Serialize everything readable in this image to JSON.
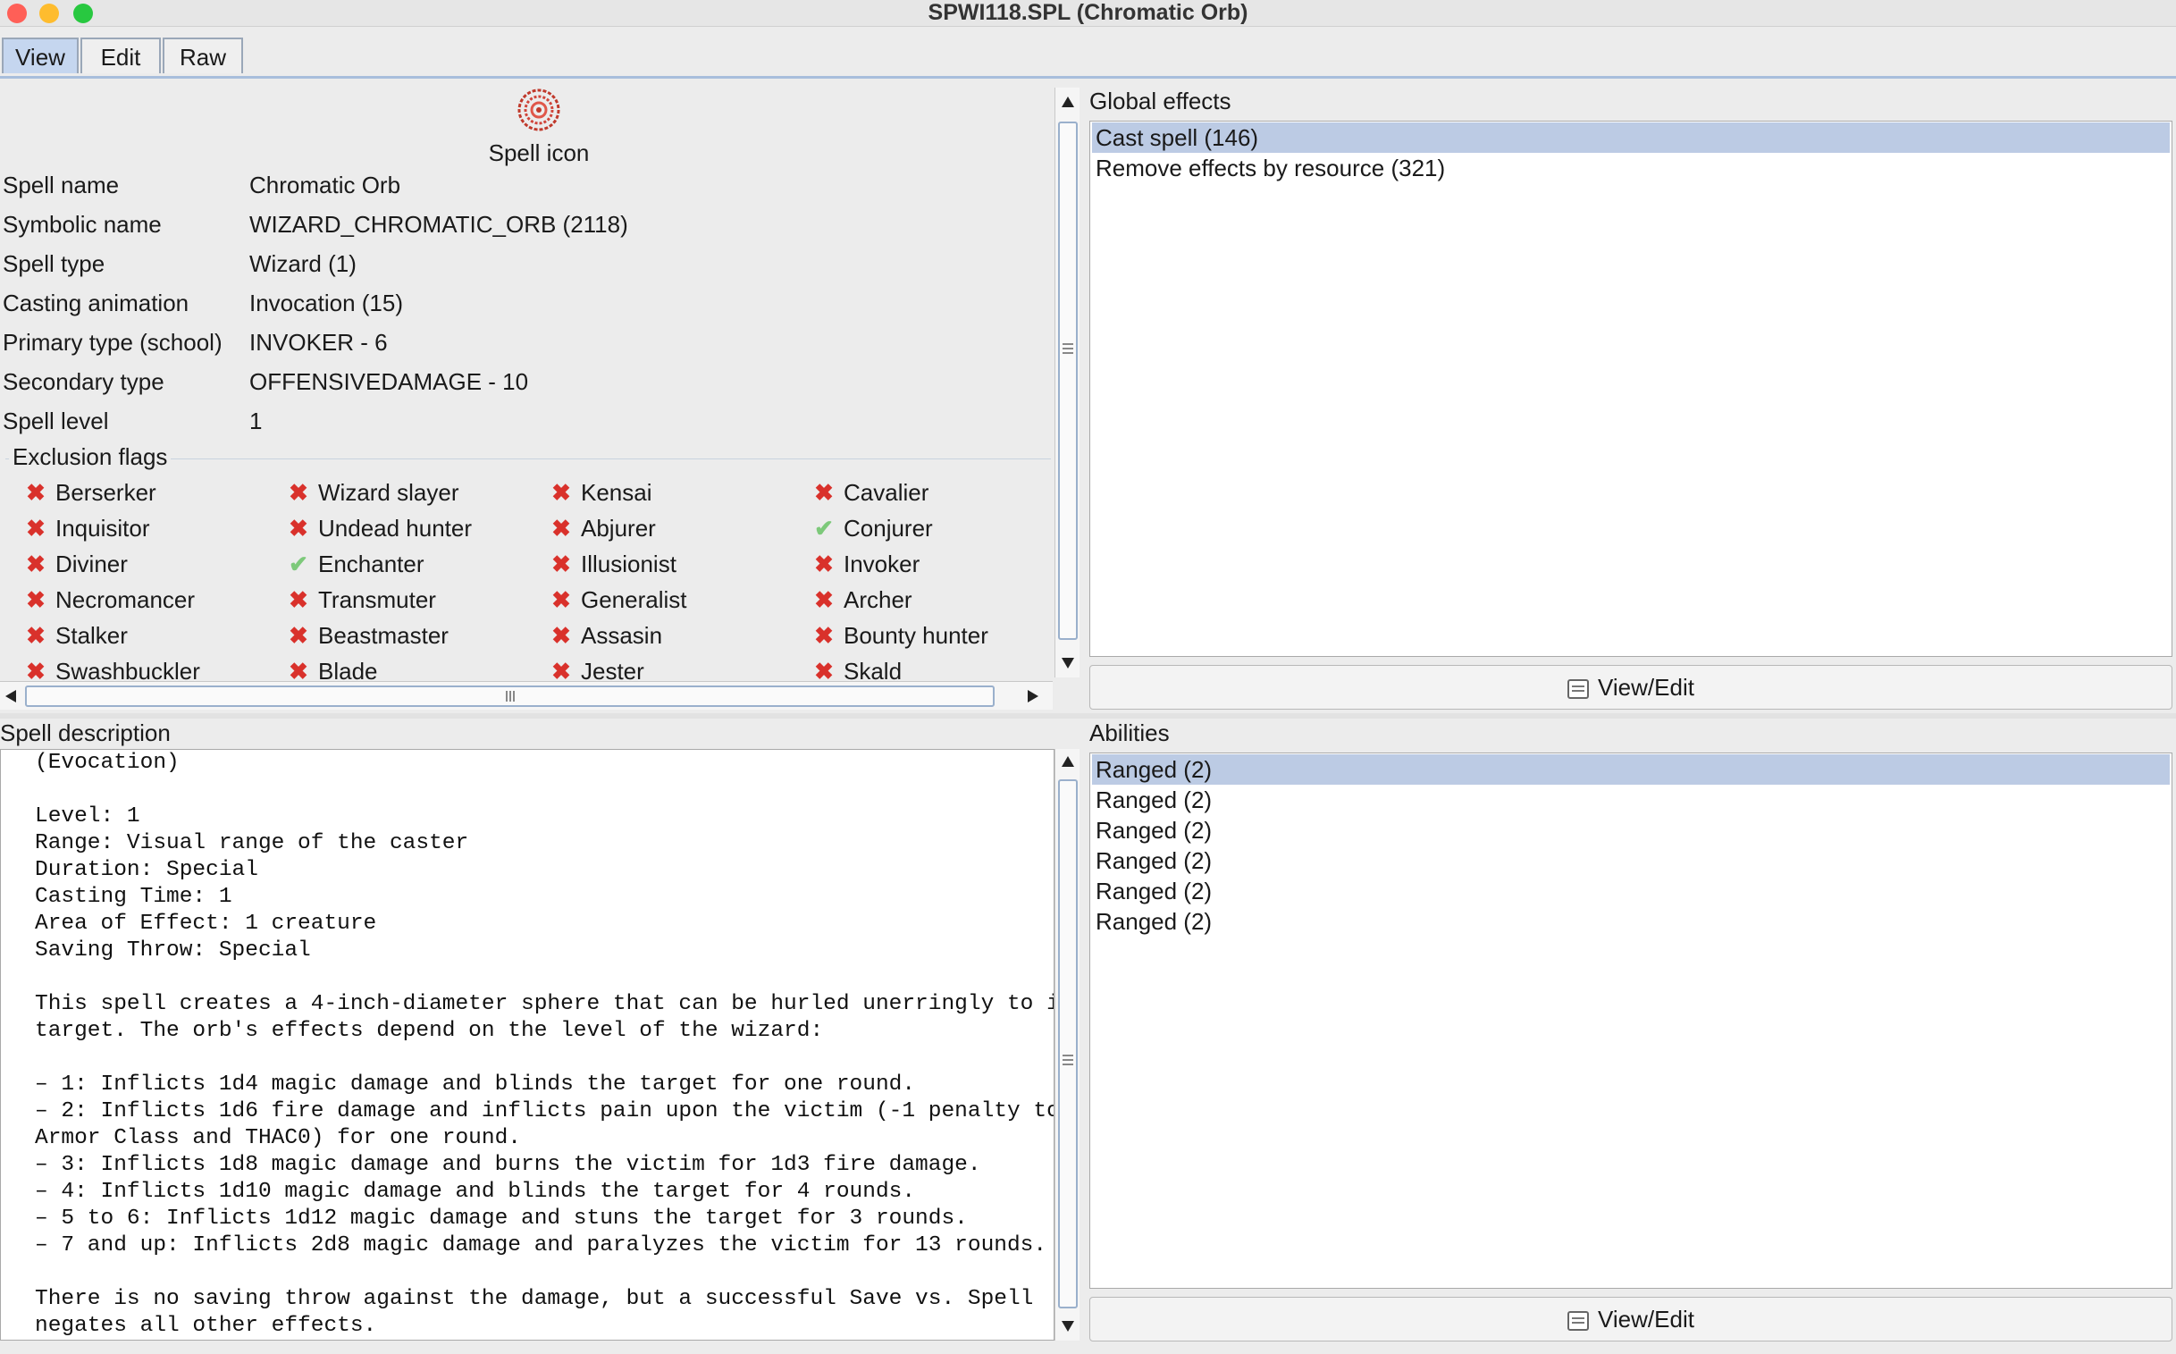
{
  "window": {
    "title": "SPWI118.SPL (Chromatic Orb)",
    "tabs": [
      "View",
      "Edit",
      "Raw"
    ]
  },
  "spell": {
    "icon_label": "Spell icon",
    "fields": [
      {
        "label": "Spell name",
        "value": "Chromatic Orb"
      },
      {
        "label": "Symbolic name",
        "value": "WIZARD_CHROMATIC_ORB (2118)"
      },
      {
        "label": "Spell type",
        "value": "Wizard (1)"
      },
      {
        "label": "Casting animation",
        "value": "Invocation (15)"
      },
      {
        "label": "Primary type (school)",
        "value": "INVOKER - 6"
      },
      {
        "label": "Secondary type",
        "value": "OFFENSIVEDAMAGE - 10"
      },
      {
        "label": "Spell level",
        "value": "1"
      }
    ]
  },
  "exclusion_flags": {
    "title": "Exclusion flags",
    "items": [
      {
        "name": "Berserker",
        "state": "excluded"
      },
      {
        "name": "Wizard slayer",
        "state": "excluded"
      },
      {
        "name": "Kensai",
        "state": "excluded"
      },
      {
        "name": "Cavalier",
        "state": "excluded"
      },
      {
        "name": "Inquisitor",
        "state": "excluded"
      },
      {
        "name": "Undead hunter",
        "state": "excluded"
      },
      {
        "name": "Abjurer",
        "state": "excluded"
      },
      {
        "name": "Conjurer",
        "state": "allowed"
      },
      {
        "name": "Diviner",
        "state": "excluded"
      },
      {
        "name": "Enchanter",
        "state": "allowed"
      },
      {
        "name": "Illusionist",
        "state": "excluded"
      },
      {
        "name": "Invoker",
        "state": "excluded"
      },
      {
        "name": "Necromancer",
        "state": "excluded"
      },
      {
        "name": "Transmuter",
        "state": "excluded"
      },
      {
        "name": "Generalist",
        "state": "excluded"
      },
      {
        "name": "Archer",
        "state": "excluded"
      },
      {
        "name": "Stalker",
        "state": "excluded"
      },
      {
        "name": "Beastmaster",
        "state": "excluded"
      },
      {
        "name": "Assasin",
        "state": "excluded"
      },
      {
        "name": "Bounty hunter",
        "state": "excluded"
      },
      {
        "name": "Swashbuckler",
        "state": "excluded"
      },
      {
        "name": "Blade",
        "state": "excluded"
      },
      {
        "name": "Jester",
        "state": "excluded"
      },
      {
        "name": "Skald",
        "state": "excluded"
      }
    ]
  },
  "global_effects": {
    "title": "Global effects",
    "items": [
      "Cast spell (146)",
      "Remove effects by resource (321)"
    ],
    "button": "View/Edit"
  },
  "description": {
    "title": "Spell description",
    "text": "(Evocation)\n\nLevel: 1\nRange: Visual range of the caster\nDuration: Special\nCasting Time: 1\nArea of Effect: 1 creature\nSaving Throw: Special\n\nThis spell creates a 4-inch-diameter sphere that can be hurled unerringly to its\ntarget. The orb's effects depend on the level of the wizard:\n\n– 1: Inflicts 1d4 magic damage and blinds the target for one round.\n– 2: Inflicts 1d6 fire damage and inflicts pain upon the victim (-1 penalty to\nArmor Class and THAC0) for one round.\n– 3: Inflicts 1d8 magic damage and burns the victim for 1d3 fire damage.\n– 4: Inflicts 1d10 magic damage and blinds the target for 4 rounds.\n– 5 to 6: Inflicts 1d12 magic damage and stuns the target for 3 rounds.\n– 7 and up: Inflicts 2d8 magic damage and paralyzes the victim for 13 rounds.\n\nThere is no saving throw against the damage, but a successful Save vs. Spell\nnegates all other effects."
  },
  "abilities": {
    "title": "Abilities",
    "items": [
      "Ranged (2)",
      "Ranged (2)",
      "Ranged (2)",
      "Ranged (2)",
      "Ranged (2)",
      "Ranged (2)"
    ],
    "button": "View/Edit"
  },
  "colors": {
    "selection": "#bccbe4",
    "excluded_mark": "#d9312b",
    "allowed_mark": "#7dc97a",
    "tab_selected": "#c5d6ef"
  }
}
